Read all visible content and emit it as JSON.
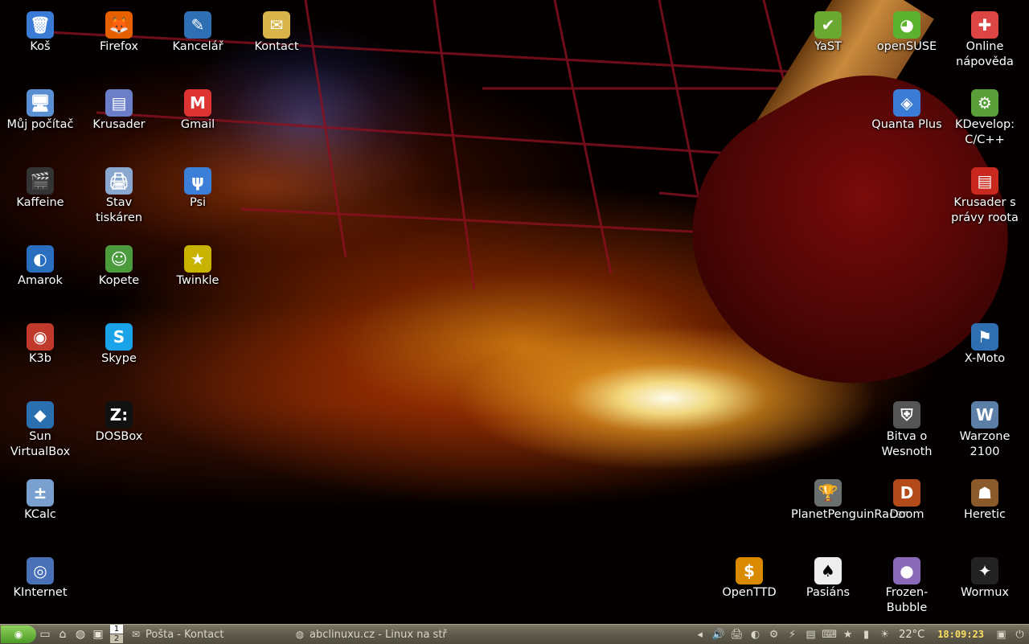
{
  "desktop": {
    "icons_left": [
      {
        "label": "Koš",
        "icon": "trash-icon",
        "glyph": "🗑",
        "color": "#3a7bd5"
      },
      {
        "label": "Firefox",
        "icon": "firefox-icon",
        "glyph": "🦊",
        "color": "#e66000"
      },
      {
        "label": "Kancelář",
        "icon": "office-icon",
        "glyph": "✎",
        "color": "#2f6fb3"
      },
      {
        "label": "Kontact",
        "icon": "kontact-icon",
        "glyph": "✉",
        "color": "#d9b44a"
      },
      {
        "label": "Můj počítač",
        "icon": "computer-icon",
        "glyph": "🖥",
        "color": "#5b8fd4"
      },
      {
        "label": "Krusader",
        "icon": "krusader-icon",
        "glyph": "▤",
        "color": "#6a7fc8"
      },
      {
        "label": "Gmail",
        "icon": "gmail-icon",
        "glyph": "M",
        "color": "#d33"
      },
      {
        "label": "Kaffeine",
        "icon": "kaffeine-icon",
        "glyph": "🎬",
        "color": "#333"
      },
      {
        "label": "Stav tiskáren",
        "icon": "printer-icon",
        "glyph": "🖨",
        "color": "#8aa8cf"
      },
      {
        "label": "Psi",
        "icon": "psi-icon",
        "glyph": "ψ",
        "color": "#3b7fd8"
      },
      {
        "label": "Amarok",
        "icon": "amarok-icon",
        "glyph": "◐",
        "color": "#2a6fbf"
      },
      {
        "label": "Kopete",
        "icon": "kopete-icon",
        "glyph": "☺",
        "color": "#4b9a3c"
      },
      {
        "label": "Twinkle",
        "icon": "twinkle-star-icon",
        "glyph": "★",
        "color": "#c8b400"
      },
      {
        "label": "K3b",
        "icon": "k3b-icon",
        "glyph": "◉",
        "color": "#c0392b"
      },
      {
        "label": "Skype",
        "icon": "skype-icon",
        "glyph": "S",
        "color": "#1aa3e8"
      },
      {
        "label": "Sun VirtualBox",
        "icon": "virtualbox-icon",
        "glyph": "◆",
        "color": "#2a6fb0"
      },
      {
        "label": "DOSBox",
        "icon": "dosbox-icon",
        "glyph": "Z:",
        "color": "#111"
      },
      {
        "label": "KCalc",
        "icon": "calculator-icon",
        "glyph": "±",
        "color": "#7aa0d0"
      },
      {
        "label": "KInternet",
        "icon": "kinternet-icon",
        "glyph": "◎",
        "color": "#4a70b8"
      }
    ],
    "icons_right": [
      {
        "label": "YaST",
        "icon": "yast-icon",
        "glyph": "✔",
        "color": "#6aa832"
      },
      {
        "label": "openSUSE",
        "icon": "opensuse-icon",
        "glyph": "◕",
        "color": "#5bb22e"
      },
      {
        "label": "Online nápověda",
        "icon": "help-lifebuoy-icon",
        "glyph": "✚",
        "color": "#d44"
      },
      {
        "label": "Quanta Plus",
        "icon": "quanta-icon",
        "glyph": "◈",
        "color": "#3a7bd5"
      },
      {
        "label": "KDevelop: C/C++",
        "icon": "kdevelop-icon",
        "glyph": "⚙",
        "color": "#5a9e3a"
      },
      {
        "label": "Krusader s právy roota",
        "icon": "krusader-root-icon",
        "glyph": "▤",
        "color": "#c8281e"
      },
      {
        "label": "X-Moto",
        "icon": "xmoto-icon",
        "glyph": "⚑",
        "color": "#2e6fb2"
      },
      {
        "label": "Bitva o Wesnoth",
        "icon": "wesnoth-icon",
        "glyph": "⛨",
        "color": "#555"
      },
      {
        "label": "Warzone 2100",
        "icon": "warzone-icon",
        "glyph": "W",
        "color": "#5c7fa8"
      },
      {
        "label": "PlanetPenguinRacer",
        "icon": "penguin-racer-icon",
        "glyph": "🏆",
        "color": "#6a7070"
      },
      {
        "label": "Doom",
        "icon": "doom-icon",
        "glyph": "D",
        "color": "#b34a1a"
      },
      {
        "label": "Heretic",
        "icon": "heretic-icon",
        "glyph": "☗",
        "color": "#8a5a2a"
      },
      {
        "label": "OpenTTD",
        "icon": "openttd-icon",
        "glyph": "$",
        "color": "#d98a00"
      },
      {
        "label": "Pasiáns",
        "icon": "cards-icon",
        "glyph": "♠",
        "color": "#eee"
      },
      {
        "label": "Frozen-Bubble",
        "icon": "frozen-bubble-icon",
        "glyph": "●",
        "color": "#8a6ab8"
      },
      {
        "label": "Wormux",
        "icon": "wormux-icon",
        "glyph": "✦",
        "color": "#222"
      }
    ]
  },
  "taskbar": {
    "menu_icon": "kde-menu-icon",
    "quicklaunch": [
      {
        "name": "show-desktop-icon",
        "glyph": "▭"
      },
      {
        "name": "home-folder-icon",
        "glyph": "⌂"
      },
      {
        "name": "browser-icon",
        "glyph": "◍"
      },
      {
        "name": "terminal-icon",
        "glyph": "▣"
      }
    ],
    "pager": {
      "current": "1",
      "other": "2"
    },
    "tasks": [
      {
        "label": "Pošta - Kontact",
        "icon": "kontact-task-icon",
        "glyph": "✉"
      },
      {
        "label": "abclinuxu.cz - Linux na stř",
        "icon": "firefox-task-icon",
        "glyph": "◍"
      }
    ],
    "tray": [
      {
        "name": "tray-arrow-icon",
        "glyph": "◂"
      },
      {
        "name": "volume-icon",
        "glyph": "🔊"
      },
      {
        "name": "printer-tray-icon",
        "glyph": "🖨"
      },
      {
        "name": "amarok-tray-icon",
        "glyph": "◐"
      },
      {
        "name": "network-tray-icon",
        "glyph": "⚙"
      },
      {
        "name": "connect-tray-icon",
        "glyph": "⚡"
      },
      {
        "name": "clipboard-tray-icon",
        "glyph": "▤"
      },
      {
        "name": "keyboard-tray-icon",
        "glyph": "⌨"
      },
      {
        "name": "twinkle-tray-icon",
        "glyph": "★"
      },
      {
        "name": "signal-tray-icon",
        "glyph": "▮"
      },
      {
        "name": "weather-tray-icon",
        "glyph": "☀"
      }
    ],
    "temperature": "22°C",
    "clock": "18:09:23",
    "end_icons": [
      {
        "name": "lock-screen-icon",
        "glyph": "▣"
      },
      {
        "name": "logout-icon",
        "glyph": "⏻"
      }
    ]
  }
}
